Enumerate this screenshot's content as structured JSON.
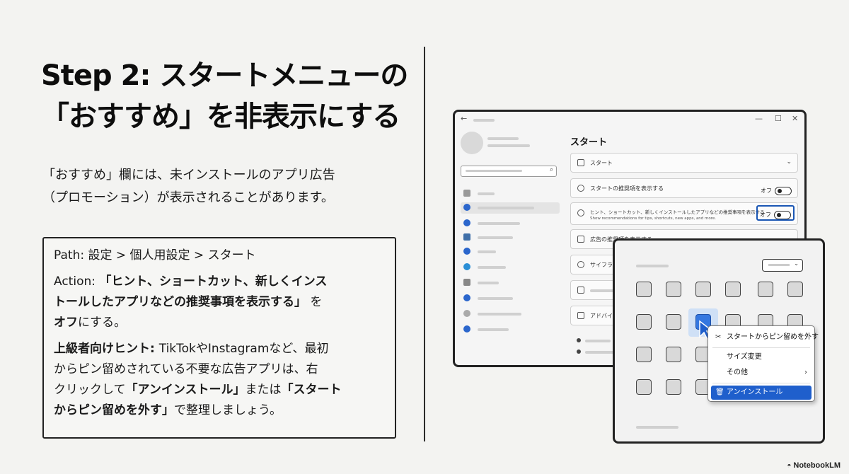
{
  "title": {
    "line1": "Step 2: スタートメニューの",
    "line2": "「おすすめ」を非表示にする"
  },
  "intro": {
    "line1": "「おすすめ」欄には、未インストールのアプリ広告",
    "line2": "（プロモーション）が表示されることがあります。"
  },
  "box": {
    "path": "Path: 設定 > 個人用設定 > スタート",
    "action_prefix": "Action: ",
    "action_bold_1": "「ヒント、ショートカット、新しくインス",
    "action_bold_2": "トールしたアプリなどの推奨事項を表示する」",
    "action_suffix_2": "を",
    "action_bold_3": "オフ",
    "action_suffix_3": "にする。",
    "tip_bold": "上級者向けヒント: ",
    "tip_1": "TikTokやInstagramなど、最初",
    "tip_2": "からピン留めされている不要な広告アプリは、右",
    "tip_3a": "クリックして",
    "tip_3b": "「アンインストール」",
    "tip_3c": "または",
    "tip_3d": "「スタート",
    "tip_4a": "からピン留めを外す」",
    "tip_4b": "で整理しましょう。"
  },
  "settings": {
    "back_icon": "←",
    "min_icon": "—",
    "max_icon": "☐",
    "close_icon": "✕",
    "pane_title": "スタート",
    "search_icon": "⌕",
    "rows": [
      {
        "label": "スタート",
        "chevron": "⌄"
      },
      {
        "label": "スタートの推奨項を表示する",
        "toggle": "オフ"
      },
      {
        "label": "ヒント、ショートカット、新しくインストールしたアプリなどの推奨事項を表示する",
        "sub": "Show recommendations for tips, shortcuts, new apps, and more.",
        "toggle": "オフ"
      },
      {
        "label": "広告の推奨項を表示する",
        "chevron": "⌄"
      },
      {
        "label": "サイフラク"
      },
      {
        "label": ""
      },
      {
        "label": "アドバイザー"
      }
    ]
  },
  "start_menu": {
    "dropdown_chevron": "⌄",
    "context_menu": {
      "unpin": "スタートからピン留めを外す",
      "resize": "サイズ変更",
      "more": "その他",
      "more_arrow": "›",
      "uninstall": "アンインストール"
    }
  },
  "brand": "NotebookLM",
  "colors": {
    "accent": "#1f5fcc",
    "toggle_highlight": "#1a56b4",
    "background": "#f3f3f1"
  }
}
